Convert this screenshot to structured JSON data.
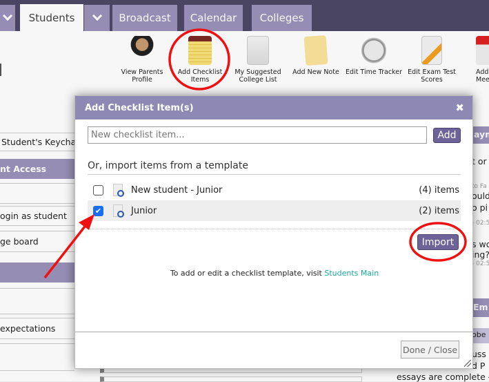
{
  "tabs": [
    {
      "label": ""
    },
    {
      "label": "Students",
      "active": true
    },
    {
      "label": ""
    },
    {
      "label": "Broadcast"
    },
    {
      "label": "Calendar"
    },
    {
      "label": "Colleges"
    }
  ],
  "toolbar": [
    {
      "label": "View Parents Profile",
      "icon": "parents-icon"
    },
    {
      "label": "Add Checklist Items",
      "icon": "notepad-icon"
    },
    {
      "label": "My Suggested College List",
      "icon": "college-list-icon"
    },
    {
      "label": "Add New Note",
      "icon": "sticky-note-icon"
    },
    {
      "label": "Edit Time Tracker",
      "icon": "stopwatch-icon"
    },
    {
      "label": "Edit Exam Test Scores",
      "icon": "exam-pencil-icon"
    },
    {
      "label": "Add Mee",
      "icon": "calendar-icon"
    }
  ],
  "sidebar": [
    "Student's Keychain",
    "nt Access",
    "",
    "ogin as student",
    "ge board",
    "",
    "",
    "expectations",
    ""
  ],
  "right_panel": {
    "h1": "aym",
    "t1": "t or",
    "s1": "to Fa",
    "l1": "ould",
    "l2": "o pi",
    "d1": "- 02:5",
    "l3": "s wo",
    "l4": "ing?",
    "d2": "- 02:5",
    "h2": "Em",
    "sub": "obe",
    "l5": "uss",
    "l6": "d P",
    "l7": "essays are complete - ho"
  },
  "dialog": {
    "title": "Add Checklist Item(s)",
    "close": "✖",
    "input_placeholder": "New checklist item...",
    "add_label": "Add",
    "template_heading": "Or, import items from a template",
    "templates": [
      {
        "name": "New student - Junior",
        "count": "(4) items",
        "checked": false
      },
      {
        "name": "Junior",
        "count": "(2) items",
        "checked": true
      }
    ],
    "import_label": "Import",
    "note": "To add or edit a checklist template, visit ",
    "note_link": "Students Main",
    "done_label": "Done / Close"
  },
  "colors": {
    "topbar": "#4e4868",
    "tab": "#9a92ba",
    "dialog_header": "#8e88b4",
    "button": "#6d6398",
    "link": "#1aa99a",
    "annotation": "#ee1111"
  }
}
